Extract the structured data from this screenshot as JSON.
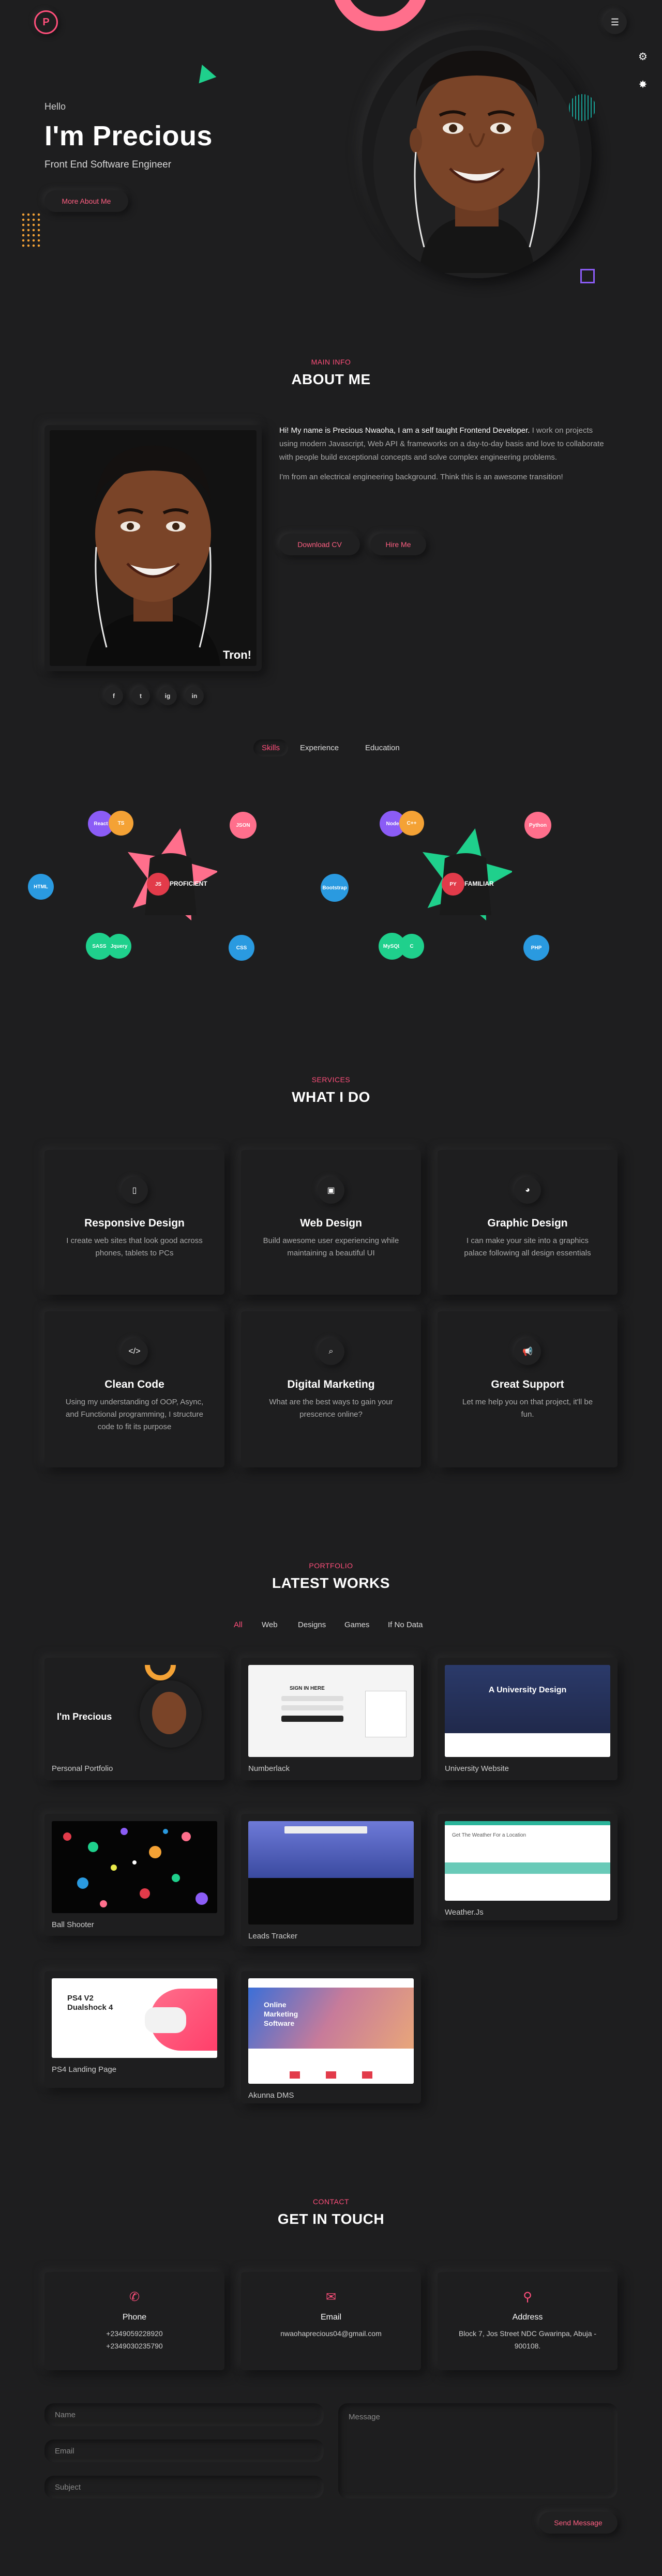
{
  "header": {
    "logo_letter": "P",
    "menu_icon": "hamburger-icon"
  },
  "hero": {
    "greeting": "Hello",
    "name": "I'm Precious",
    "role": "Front End Software Engineer",
    "cta": "More About Me"
  },
  "about": {
    "kicker": "MAIN INFO",
    "title": "ABOUT ME",
    "intro_bold": "Hi! My name is Precious Nwaoha, I am a self taught Frontend Developer.",
    "intro_rest": " I work on projects using modern Javascript, Web API & frameworks on a day-to-day basis and love to collaborate with people build exceptional concepts and solve complex engineering problems.",
    "para2": "I'm from an electrical engineering background. Think this is an awesome transition!",
    "download_cv": "Download CV",
    "hire_me": "Hire Me",
    "photo_caption": "Tron!",
    "socials": [
      "f",
      "t",
      "ig",
      "in"
    ]
  },
  "tabs": [
    "Skills",
    "Experience",
    "Education"
  ],
  "skills": {
    "proficient": {
      "label": "PROFICIENT",
      "badge": "JS",
      "bubbles": [
        "React",
        "TS",
        "JSON",
        "HTML",
        "SASS",
        "Jquery",
        "CSS"
      ]
    },
    "familiar": {
      "label": "FAMILIAR",
      "badge": "PY",
      "bubbles": [
        "Node",
        "C++",
        "Python",
        "Bootstrap",
        "MySQL",
        "C",
        "PHP"
      ]
    }
  },
  "services": {
    "kicker": "SERVICES",
    "title": "WHAT I DO",
    "items": [
      {
        "icon": "mobile-icon",
        "title": "Responsive Design",
        "desc": "I create web sites that look good across phones, tablets to PCs"
      },
      {
        "icon": "monitor-icon",
        "title": "Web Design",
        "desc": "Build awesome user experiencing while maintaining a beautiful UI"
      },
      {
        "icon": "palette-icon",
        "title": "Graphic Design",
        "desc": "I can make your site into a graphics palace following all design essentials"
      },
      {
        "icon": "code-icon",
        "title": "Clean Code",
        "desc": "Using my understanding of OOP, Async, and Functional programming, I structure code to fit its purpose"
      },
      {
        "icon": "search-icon",
        "title": "Digital Marketing",
        "desc": "What are the best ways to gain your prescence online?"
      },
      {
        "icon": "megaphone-icon",
        "title": "Great Support",
        "desc": "Let me help you on that project, it'll be fun."
      }
    ]
  },
  "portfolio": {
    "kicker": "PORTFOLIO",
    "title": "LATEST WORKS",
    "filters": [
      "All",
      "Web",
      "Designs",
      "Games",
      "If No Data"
    ],
    "works": [
      {
        "label": "Personal Portfolio",
        "thumb_title": "I'm Precious"
      },
      {
        "label": "Numberlack",
        "thumb_title": "SIGN IN HERE"
      },
      {
        "label": "University Website",
        "thumb_title": "A University Design"
      },
      {
        "label": "Ball Shooter",
        "thumb_title": ""
      },
      {
        "label": "Leads Tracker",
        "thumb_title": ""
      },
      {
        "label": "Weather.Js",
        "thumb_title": "Get The Weather For a Location"
      },
      {
        "label": "PS4 Landing Page",
        "thumb_title": "PS4 V2 Dualshock 4"
      },
      {
        "label": "Akunna DMS",
        "thumb_title": "Online Marketing Software"
      }
    ]
  },
  "contact": {
    "kicker": "CONTACT",
    "title": "GET IN TOUCH",
    "cards": [
      {
        "icon": "phone-icon",
        "title": "Phone",
        "lines": [
          "+2349059228920",
          "+2349030235790"
        ]
      },
      {
        "icon": "envelope-icon",
        "title": "Email",
        "lines": [
          "nwaohaprecious04@gmail.com"
        ]
      },
      {
        "icon": "location-pin-icon",
        "title": "Address",
        "lines": [
          "Block 7, Jos Street NDC Gwarinpa, Abuja - 900108."
        ]
      }
    ],
    "form": {
      "name_placeholder": "Name",
      "email_placeholder": "Email",
      "subject_placeholder": "Subject",
      "message_placeholder": "Message",
      "send": "Send Message"
    }
  },
  "colors": {
    "accent": "#ff4f7b",
    "bg": "#1e1e1f",
    "green": "#1fd08c",
    "blue": "#2a9ae0",
    "purple": "#8b5cf6",
    "orange": "#f4a235"
  }
}
